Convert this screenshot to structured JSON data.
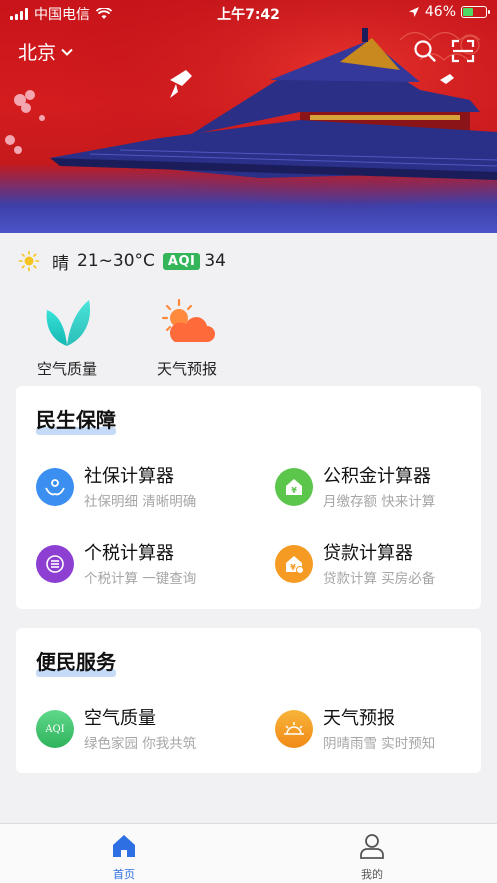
{
  "status_bar": {
    "carrier": "中国电信",
    "time": "上午7:42",
    "battery": "46%",
    "battery_level": 0.46
  },
  "header": {
    "city": "北京",
    "icons": [
      "chevron-down-icon",
      "search-icon",
      "scan-icon"
    ]
  },
  "weather": {
    "condition": "晴",
    "temperature": "21~30°C",
    "aqi_label": "AQI",
    "aqi_value": "34",
    "icon": "sun-icon"
  },
  "shortcuts": [
    {
      "label": "空气质量",
      "icon": "leaf-icon"
    },
    {
      "label": "天气预报",
      "icon": "sun-cloud-icon"
    }
  ],
  "sections": [
    {
      "title": "民生保障",
      "items": [
        {
          "name": "社保计算器",
          "desc": "社保明细 清晰明确",
          "icon": "social-security-icon",
          "color": "#3a8ff0"
        },
        {
          "name": "公积金计算器",
          "desc": "月缴存额 快来计算",
          "icon": "housing-fund-icon",
          "color": "#5cc54c"
        },
        {
          "name": "个税计算器",
          "desc": "个税计算 一键查询",
          "icon": "tax-icon",
          "color": "#8d3fd2"
        },
        {
          "name": "贷款计算器",
          "desc": "贷款计算 买房必备",
          "icon": "loan-icon",
          "color": "#f59a22"
        }
      ]
    },
    {
      "title": "便民服务",
      "items": [
        {
          "name": "空气质量",
          "desc": "绿色家园 你我共筑",
          "icon": "aqi-icon",
          "icon_text": "AQI",
          "color": "#43c86e"
        },
        {
          "name": "天气预报",
          "desc": "阴晴雨雪 实时预知",
          "icon": "weather-icon",
          "color": "#f39a1e"
        }
      ]
    }
  ],
  "tabbar": [
    {
      "label": "首页",
      "icon": "home-icon",
      "active": true,
      "color": "#2f6fe4"
    },
    {
      "label": "我的",
      "icon": "user-icon",
      "active": false,
      "color": "#555555"
    }
  ]
}
